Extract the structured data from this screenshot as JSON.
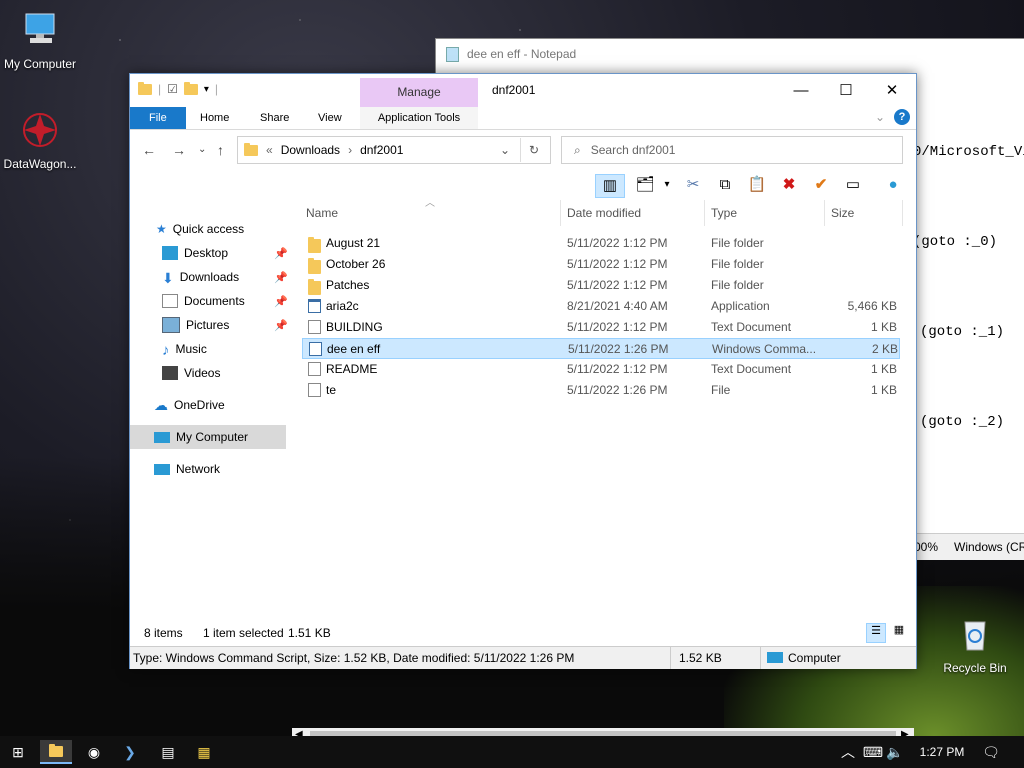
{
  "desktop": {
    "icons": [
      {
        "label": "My Computer"
      },
      {
        "label": "DataWagon..."
      },
      {
        "label": "Recycle Bin"
      }
    ]
  },
  "notepad": {
    "title": "dee en eff - Notepad",
    "lines": [
      "0/Microsoft_Vi",
      "(goto :_0)",
      "(goto :_1)",
      "(goto :_2)"
    ],
    "status_zoom": "00%",
    "status_encoding": "Windows (CR"
  },
  "explorer": {
    "title": "dnf2001",
    "manage_label": "Manage",
    "tabs": {
      "file": "File",
      "home": "Home",
      "share": "Share",
      "view": "View",
      "apptools": "Application Tools"
    },
    "breadcrumb": {
      "prefix": "«",
      "parts": [
        "Downloads",
        "dnf2001"
      ]
    },
    "search_placeholder": "Search dnf2001",
    "columns": {
      "name": "Name",
      "date": "Date modified",
      "type": "Type",
      "size": "Size"
    },
    "nav": [
      {
        "label": "Quick access"
      },
      {
        "label": "Desktop",
        "pinned": true
      },
      {
        "label": "Downloads",
        "pinned": true
      },
      {
        "label": "Documents",
        "pinned": true
      },
      {
        "label": "Pictures",
        "pinned": true
      },
      {
        "label": "Music"
      },
      {
        "label": "Videos"
      },
      {
        "label": "OneDrive"
      },
      {
        "label": "My Computer",
        "selected": true
      },
      {
        "label": "Network"
      }
    ],
    "files": [
      {
        "name": "August 21",
        "date": "5/11/2022 1:12 PM",
        "type": "File folder",
        "size": "",
        "icon": "folder"
      },
      {
        "name": "October 26",
        "date": "5/11/2022 1:12 PM",
        "type": "File folder",
        "size": "",
        "icon": "folder"
      },
      {
        "name": "Patches",
        "date": "5/11/2022 1:12 PM",
        "type": "File folder",
        "size": "",
        "icon": "folder"
      },
      {
        "name": "aria2c",
        "date": "8/21/2021 4:40 AM",
        "type": "Application",
        "size": "5,466 KB",
        "icon": "app"
      },
      {
        "name": "BUILDING",
        "date": "5/11/2022 1:12 PM",
        "type": "Text Document",
        "size": "1 KB",
        "icon": "doc"
      },
      {
        "name": "dee en eff",
        "date": "5/11/2022 1:26 PM",
        "type": "Windows Comma...",
        "size": "2 KB",
        "icon": "script",
        "selected": true
      },
      {
        "name": "README",
        "date": "5/11/2022 1:12 PM",
        "type": "Text Document",
        "size": "1 KB",
        "icon": "doc"
      },
      {
        "name": "te",
        "date": "5/11/2022 1:26 PM",
        "type": "File",
        "size": "1 KB",
        "icon": "doc"
      }
    ],
    "status": {
      "items": "8 items",
      "selected": "1 item selected",
      "selsize": "1.51 KB"
    },
    "details": {
      "text": "Type: Windows Command Script, Size: 1.52 KB, Date modified: 5/11/2022 1:26 PM",
      "size": "1.52 KB",
      "location": "Computer"
    }
  },
  "taskbar": {
    "time": "1:27 PM"
  },
  "colors": {
    "accent": "#1979ca",
    "selection": "#cce8ff",
    "manage": "#e9c8f5"
  }
}
